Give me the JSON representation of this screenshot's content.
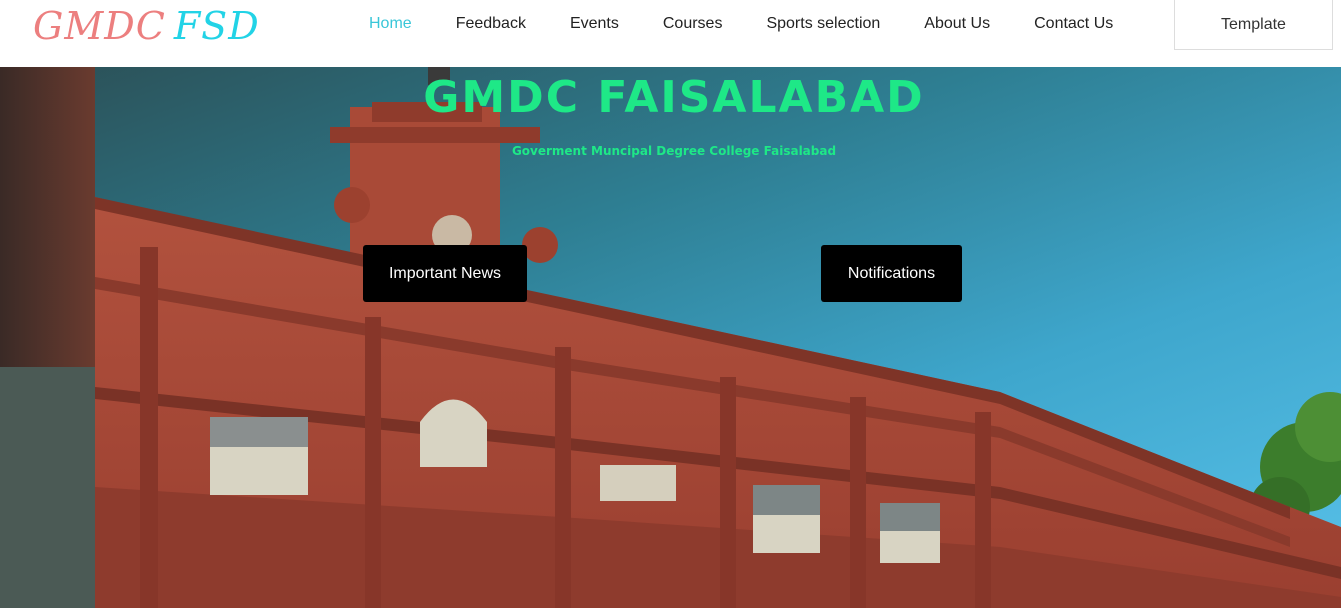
{
  "brand": {
    "part1": "GMDC",
    "part2": "FSD"
  },
  "nav": {
    "items": [
      {
        "label": "Home",
        "active": true
      },
      {
        "label": "Feedback",
        "active": false
      },
      {
        "label": "Events",
        "active": false
      },
      {
        "label": "Courses",
        "active": false
      },
      {
        "label": "Sports selection",
        "active": false
      },
      {
        "label": "About Us",
        "active": false
      },
      {
        "label": "Contact Us",
        "active": false
      }
    ],
    "template_label": "Template"
  },
  "hero": {
    "title": "GMDC FAISALABAD",
    "subtitle": "Goverment Muncipal Degree College Faisalabad",
    "buttons": {
      "news": "Important News",
      "notifications": "Notifications"
    }
  },
  "colors": {
    "accent": "#39c6d8",
    "logo_part1": "#ec7f7f",
    "logo_part2": "#22d3e6",
    "hero_text": "#1ee887",
    "button_bg": "#000000"
  }
}
